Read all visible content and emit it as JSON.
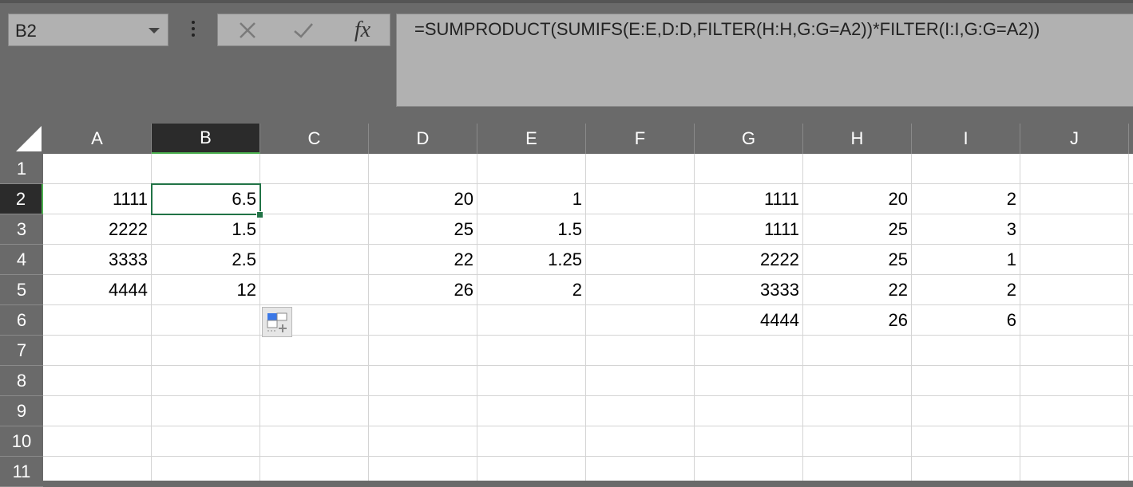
{
  "namebox": {
    "value": "B2"
  },
  "formula_bar": {
    "cancel_icon": "x-icon",
    "enter_icon": "check-icon",
    "fx_label": "fx",
    "formula": "=SUMPRODUCT(SUMIFS(E:E,D:D,FILTER(H:H,G:G=A2))*FILTER(I:I,G:G=A2))"
  },
  "columns": [
    "A",
    "B",
    "C",
    "D",
    "E",
    "F",
    "G",
    "H",
    "I",
    "J"
  ],
  "rows": [
    "1",
    "2",
    "3",
    "4",
    "5",
    "6",
    "7",
    "8",
    "9",
    "10",
    "11"
  ],
  "selected": {
    "column": "B",
    "row": "2"
  },
  "cells": {
    "A2": "1111",
    "A3": "2222",
    "A4": "3333",
    "A5": "4444",
    "B2": "6.5",
    "B3": "1.5",
    "B4": "2.5",
    "B5": "12",
    "D2": "20",
    "D3": "25",
    "D4": "22",
    "D5": "26",
    "E2": "1",
    "E3": "1.5",
    "E4": "1.25",
    "E5": "2",
    "G2": "1111",
    "G3": "1111",
    "G4": "2222",
    "G5": "3333",
    "G6": "4444",
    "H2": "20",
    "H3": "25",
    "H4": "25",
    "H5": "22",
    "H6": "26",
    "I2": "2",
    "I3": "3",
    "I4": "1",
    "I5": "2",
    "I6": "6"
  },
  "colors": {
    "accent": "#217346",
    "header_bg": "#6a6a6a",
    "selected_header_bg": "#2b2b2b"
  }
}
